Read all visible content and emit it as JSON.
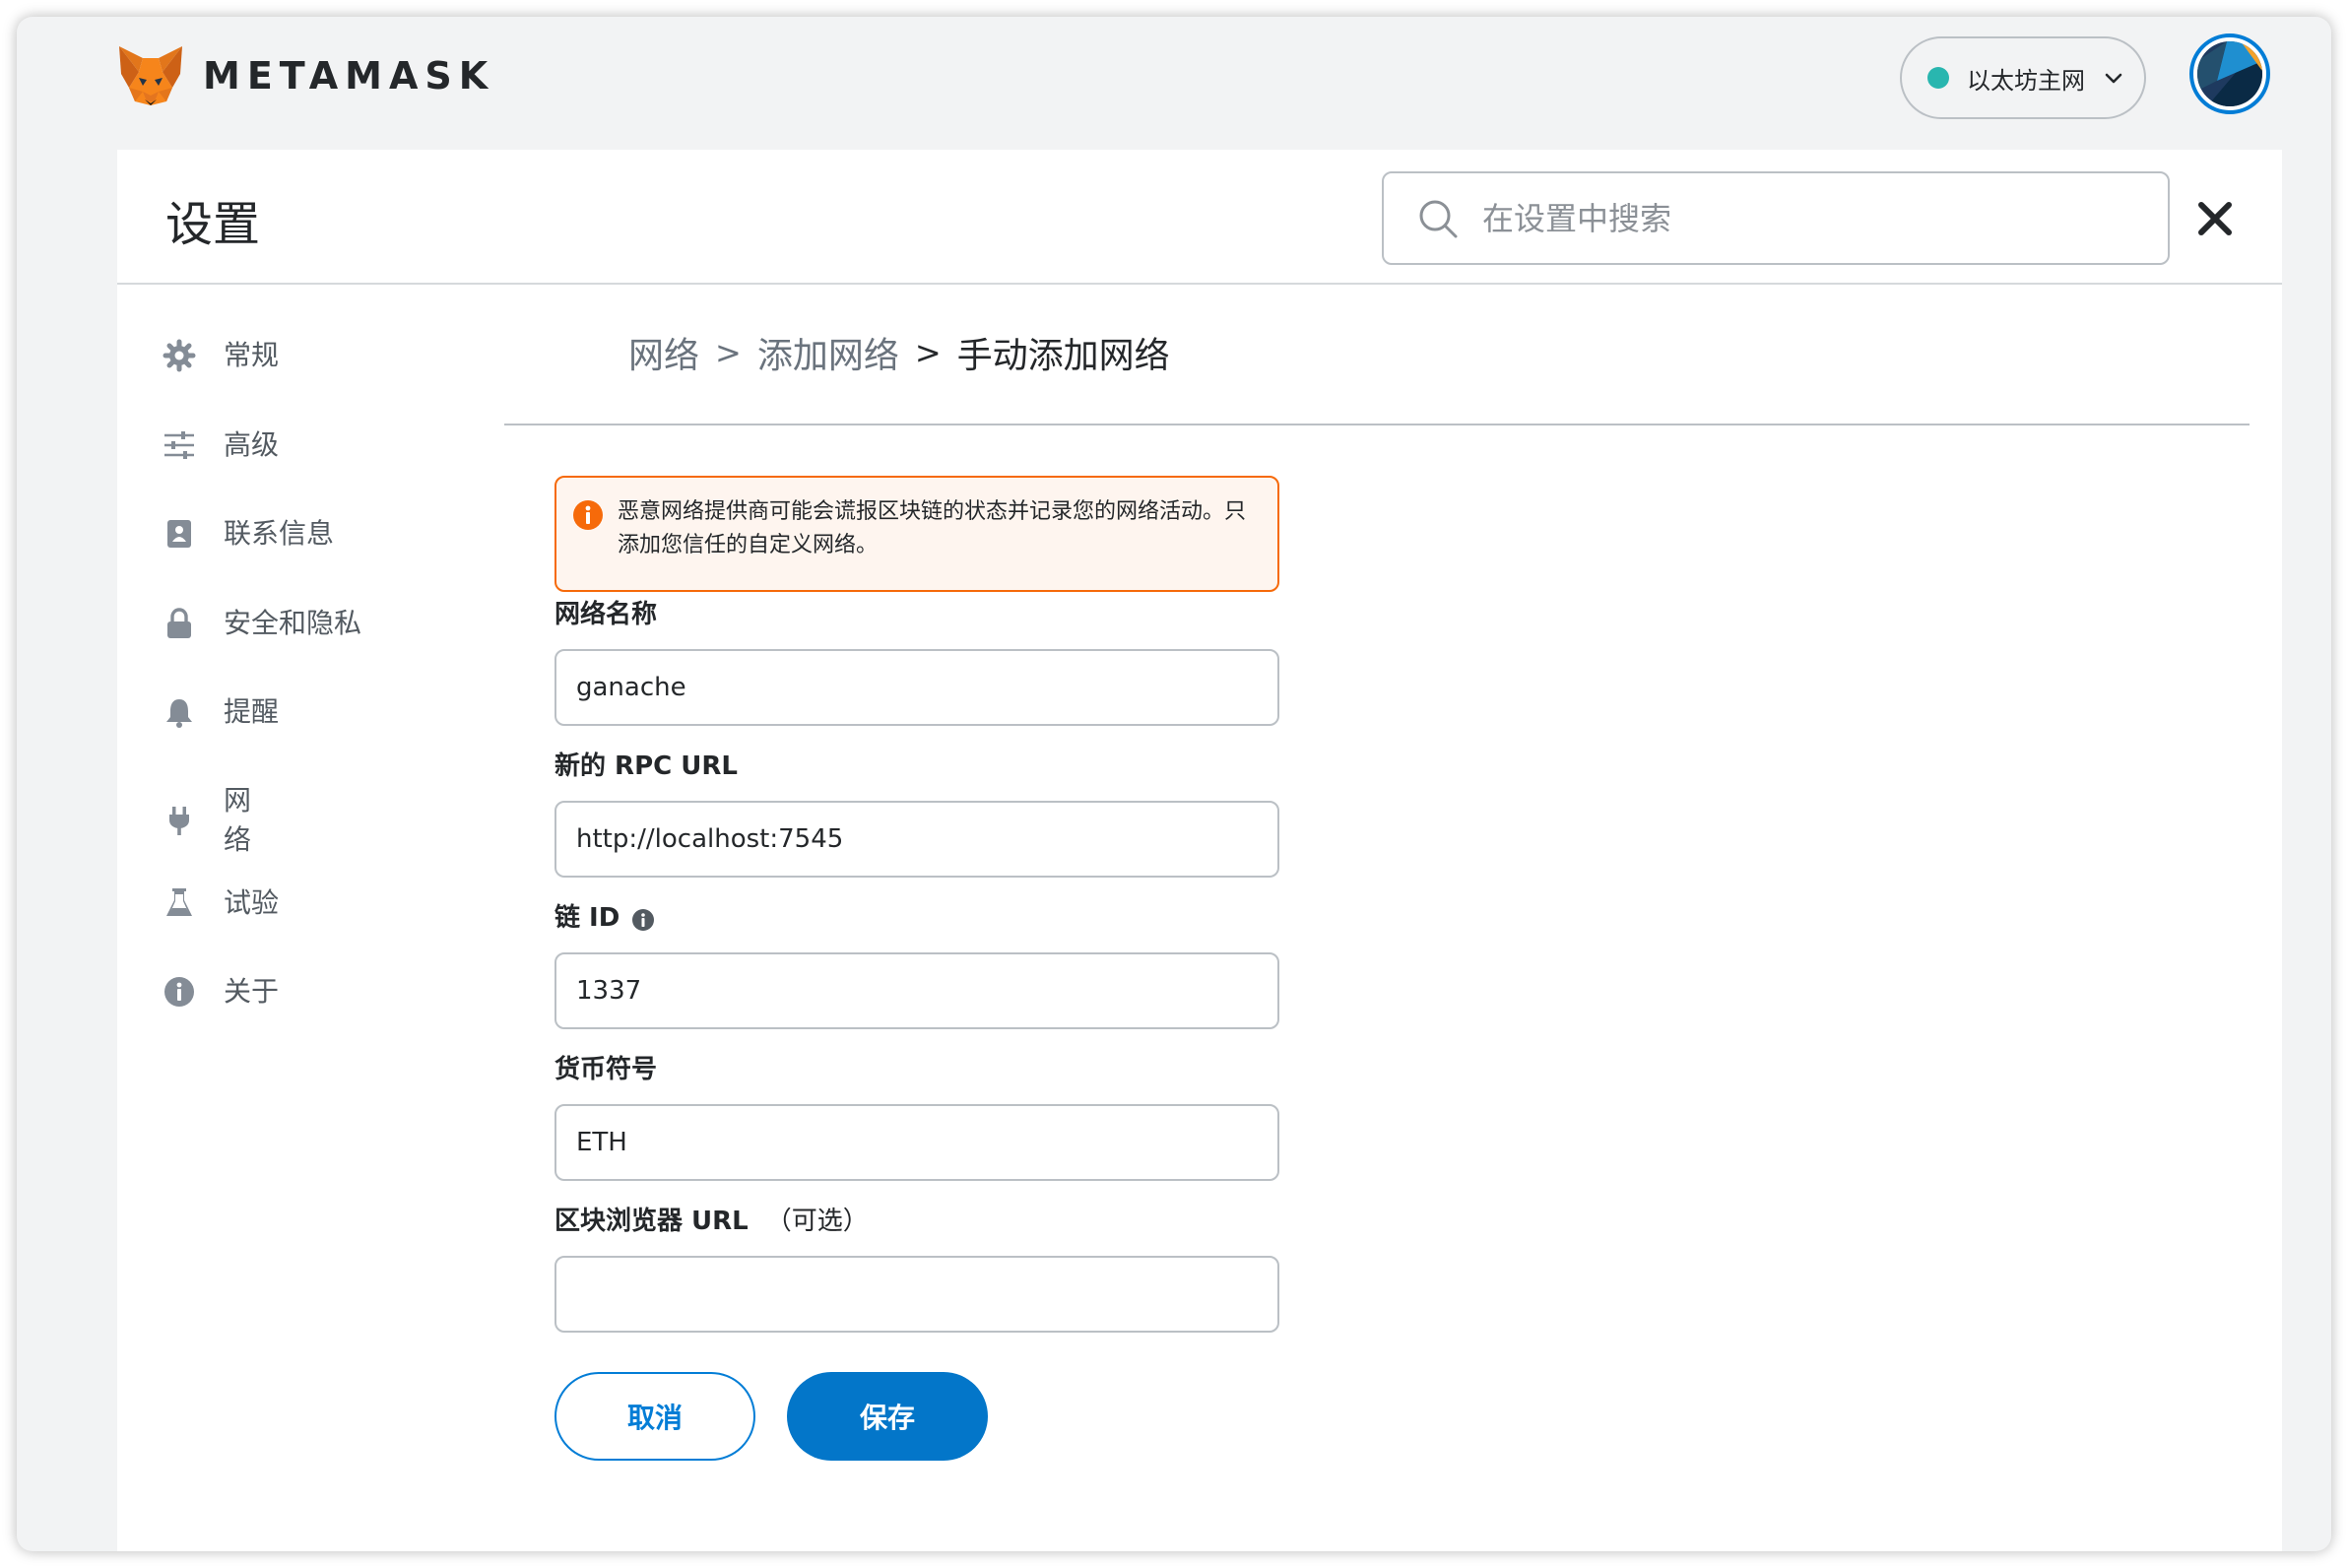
{
  "app": {
    "wordmark": "METAMASK"
  },
  "network_selector": {
    "label": "以太坊主网",
    "status_color": "#29b6af"
  },
  "settings": {
    "title": "设置",
    "search_placeholder": "在设置中搜索"
  },
  "sidebar": {
    "items": [
      {
        "label": "常规",
        "icon": "gear-icon"
      },
      {
        "label": "高级",
        "icon": "sliders-icon"
      },
      {
        "label": "联系信息",
        "icon": "contact-book-icon"
      },
      {
        "label": "安全和隐私",
        "icon": "lock-icon"
      },
      {
        "label": "提醒",
        "icon": "bell-icon"
      },
      {
        "label": "网\n络",
        "icon": "plug-icon"
      },
      {
        "label": "试验",
        "icon": "flask-icon"
      },
      {
        "label": "关于",
        "icon": "info-icon"
      }
    ]
  },
  "breadcrumb": {
    "items": [
      "网络",
      "添加网络",
      "手动添加网络"
    ],
    "separator": ">"
  },
  "warning": {
    "text": "恶意网络提供商可能会谎报区块链的状态并记录您的网络活动。只添加您信任的自定义网络。",
    "border_color": "#f66a0a"
  },
  "form": {
    "network_name": {
      "label": "网络名称",
      "value": "ganache"
    },
    "rpc_url": {
      "label": "新的 RPC URL",
      "value": "http://localhost:7545"
    },
    "chain_id": {
      "label": "链 ID",
      "value": "1337"
    },
    "currency_symbol": {
      "label": "货币符号",
      "value": "ETH"
    },
    "explorer_url": {
      "label": "区块浏览器 URL",
      "optional": "（可选）",
      "value": ""
    }
  },
  "buttons": {
    "cancel": "取消",
    "save": "保存"
  },
  "colors": {
    "accent": "#037dd6",
    "primary_button": "#0376c9"
  }
}
